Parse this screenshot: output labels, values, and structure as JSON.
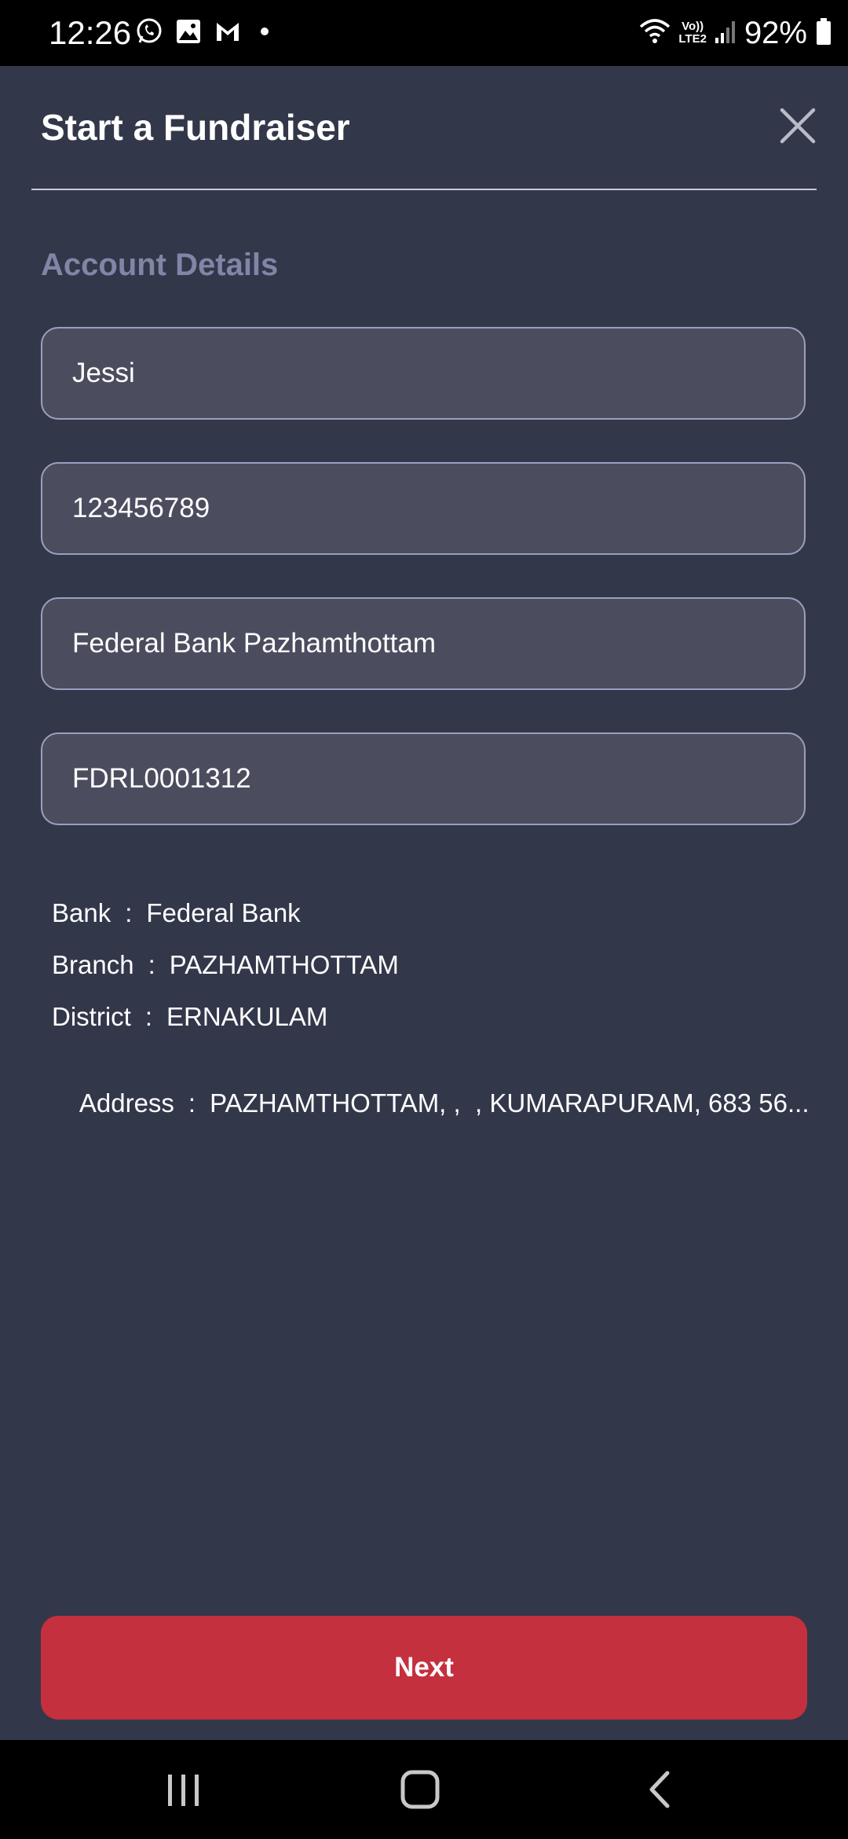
{
  "status_bar": {
    "time": "12:26",
    "battery": "92%",
    "network": "LTE2",
    "volte": "Vo))"
  },
  "header": {
    "title": "Start a Fundraiser"
  },
  "section": {
    "title": "Account Details"
  },
  "form": {
    "account_name": "Jessi",
    "account_number": "123456789",
    "branch_name": "Federal Bank Pazhamthottam",
    "ifsc": "FDRL0001312"
  },
  "bank_info": {
    "bank_label": "Bank",
    "bank_value": "Federal Bank",
    "branch_label": "Branch",
    "branch_value": "PAZHAMTHOTTAM",
    "district_label": "District",
    "district_value": "ERNAKULAM",
    "address_label": "Address",
    "address_value": "PAZHAMTHOTTAM, ,  , KUMARAPURAM, 683 56...",
    "separator": ":"
  },
  "actions": {
    "next_label": "Next"
  },
  "colors": {
    "background": "#33374a",
    "field_bg": "#4b4d5f",
    "field_border": "#9a9fbf",
    "section_title": "#7f86a6",
    "primary_button": "#c4303e"
  },
  "icons": {
    "close": "close-icon",
    "whatsapp": "whatsapp-icon",
    "gallery": "gallery-icon",
    "gmail": "gmail-icon",
    "wifi": "wifi-icon",
    "signal": "signal-icon",
    "battery": "battery-icon",
    "recents": "recents-icon",
    "home": "home-icon",
    "back": "back-icon"
  }
}
